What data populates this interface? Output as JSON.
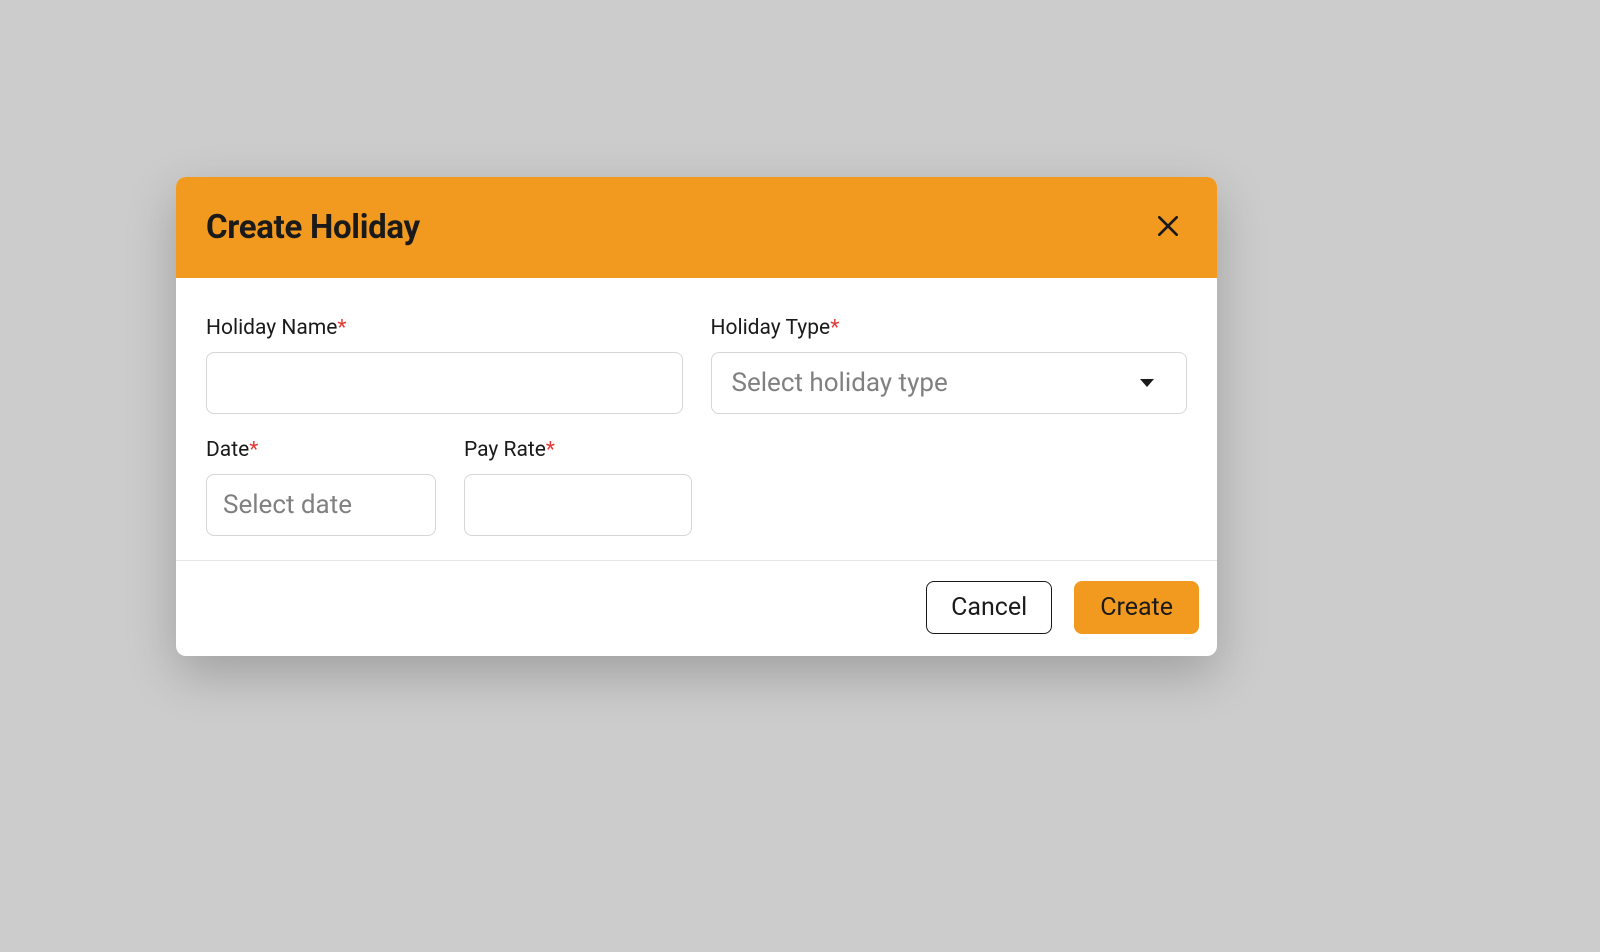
{
  "modal": {
    "title": "Create Holiday",
    "fields": {
      "holiday_name": {
        "label": "Holiday Name",
        "value": ""
      },
      "holiday_type": {
        "label": "Holiday Type",
        "placeholder": "Select holiday type"
      },
      "date": {
        "label": "Date",
        "placeholder": "Select date"
      },
      "pay_rate": {
        "label": "Pay Rate",
        "value": ""
      }
    },
    "required_mark": "*",
    "buttons": {
      "cancel": "Cancel",
      "create": "Create"
    }
  }
}
